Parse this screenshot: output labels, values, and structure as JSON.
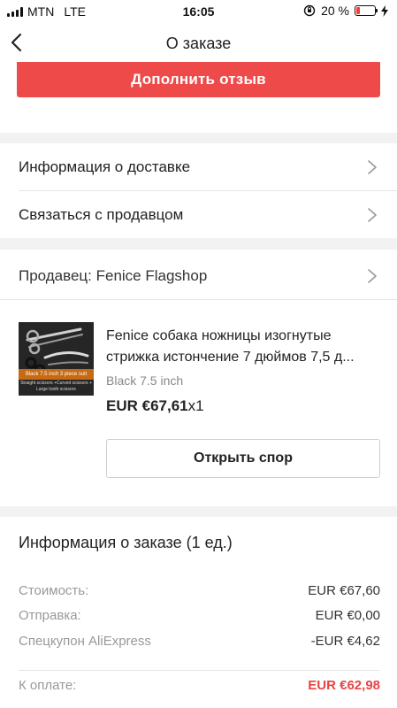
{
  "status_bar": {
    "carrier": "MTN",
    "network": "LTE",
    "time": "16:05",
    "battery": "20 %",
    "battery_level": 0.2
  },
  "nav": {
    "title": "О заказе"
  },
  "actions": {
    "review_label": "Дополнить отзыв"
  },
  "links": [
    {
      "label": "Информация о доставке"
    },
    {
      "label": "Связаться с продавцом"
    }
  ],
  "seller": {
    "label": "Продавец: Fenice Flagshop"
  },
  "product": {
    "title": "Fenice собака ножницы изогнутые стрижка истончение 7 дюймов 7,5 д...",
    "variant": "Black 7.5 inch",
    "price": "EUR €67,61",
    "quantity": "x1",
    "thumb_banner": "Black 7.5 inch 3 piece suit",
    "thumb_sub": "Straight scissors +Curved scissors + Large tooth scissors",
    "dispute_label": "Открыть спор"
  },
  "order": {
    "heading": "Информация о заказе (1 ед.)",
    "rows": [
      {
        "label": "Стоимость:",
        "value": "EUR €67,60"
      },
      {
        "label": "Отправка:",
        "value": "EUR €0,00"
      },
      {
        "label": "Спецкупон AliExpress",
        "value": "-EUR €4,62"
      }
    ],
    "total": {
      "label": "К оплате:",
      "value": "EUR €62,98"
    }
  },
  "colors": {
    "accent_red": "#ef4a4a",
    "total_red": "#e94343"
  }
}
